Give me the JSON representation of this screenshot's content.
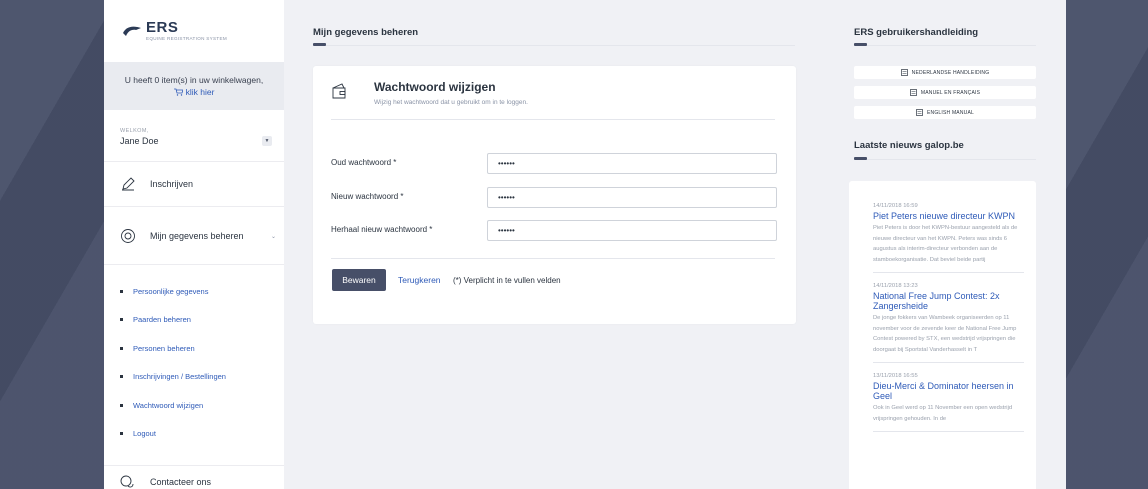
{
  "brand": {
    "name": "ERS",
    "subtitle": "EQUINE REGISTRATION SYSTEM"
  },
  "cart": {
    "text": "U heeft 0 item(s) in uw winkelwagen,",
    "link": "klik hier"
  },
  "user": {
    "welcome_label": "WELKOM,",
    "name": "Jane Doe"
  },
  "nav": {
    "register": "Inschrijven",
    "my_data": "Mijn gegevens beheren",
    "sub_items": [
      {
        "label": "Persoonlijke gegevens"
      },
      {
        "label": "Paarden beheren"
      },
      {
        "label": "Personen beheren"
      },
      {
        "label": "Inschrijvingen / Bestellingen"
      },
      {
        "label": "Wachtwoord wijzigen"
      },
      {
        "label": "Logout"
      }
    ],
    "contact": "Contacteer ons"
  },
  "main": {
    "section_title": "Mijn gegevens beheren",
    "card": {
      "title": "Wachtwoord wijzigen",
      "subtitle": "Wijzig het wachtwoord dat u gebruikt om in te loggen.",
      "fields": [
        {
          "label": "Oud wachtwoord *",
          "value": "••••••"
        },
        {
          "label": "Nieuw wachtwoord *",
          "value": "••••••"
        },
        {
          "label": "Herhaal nieuw wachtwoord *",
          "value": "••••••"
        }
      ],
      "save": "Bewaren",
      "back": "Terugkeren",
      "required_note": "(*) Verplicht in te vullen velden"
    }
  },
  "sidebar_right": {
    "manual_title": "ERS gebruikershandleiding",
    "manuals": [
      {
        "label": "NEDERLANDSE HANDLEIDING"
      },
      {
        "label": "MANUEL EN FRANÇAIS"
      },
      {
        "label": "ENGLISH MANUAL"
      }
    ],
    "news_title": "Laatste nieuws galop.be",
    "news": [
      {
        "date": "14/11/2018 16:59",
        "title": "Piet Peters nieuwe directeur KWPN",
        "body": "Piet Peters is door het KWPN-bestuur aangesteld als de nieuwe directeur van het KWPN. Peters was sinds 6 augustus als interim-directeur verbonden aan de stamboekorganisatie. Dat beviel beide partij"
      },
      {
        "date": "14/11/2018 13:23",
        "title": "National Free Jump Contest: 2x Zangersheide",
        "body": "De jonge fokkers van Wambeek organiseerden op 11 november voor de zevende keer de National Free Jump Contest powered by STX, een wedstrijd vrijspringen die doorgaat bij Sportstal Vanderhasselt in T"
      },
      {
        "date": "13/11/2018 16:55",
        "title": "Dieu-Merci & Dominator heersen in Geel",
        "body": "Ook in Geel werd op 11 November een open wedstrijd vrijspringen gehouden. In de"
      }
    ]
  },
  "colors": {
    "accent": "#474f68",
    "link": "#2f5bb8",
    "background": "#f0f1f5"
  }
}
